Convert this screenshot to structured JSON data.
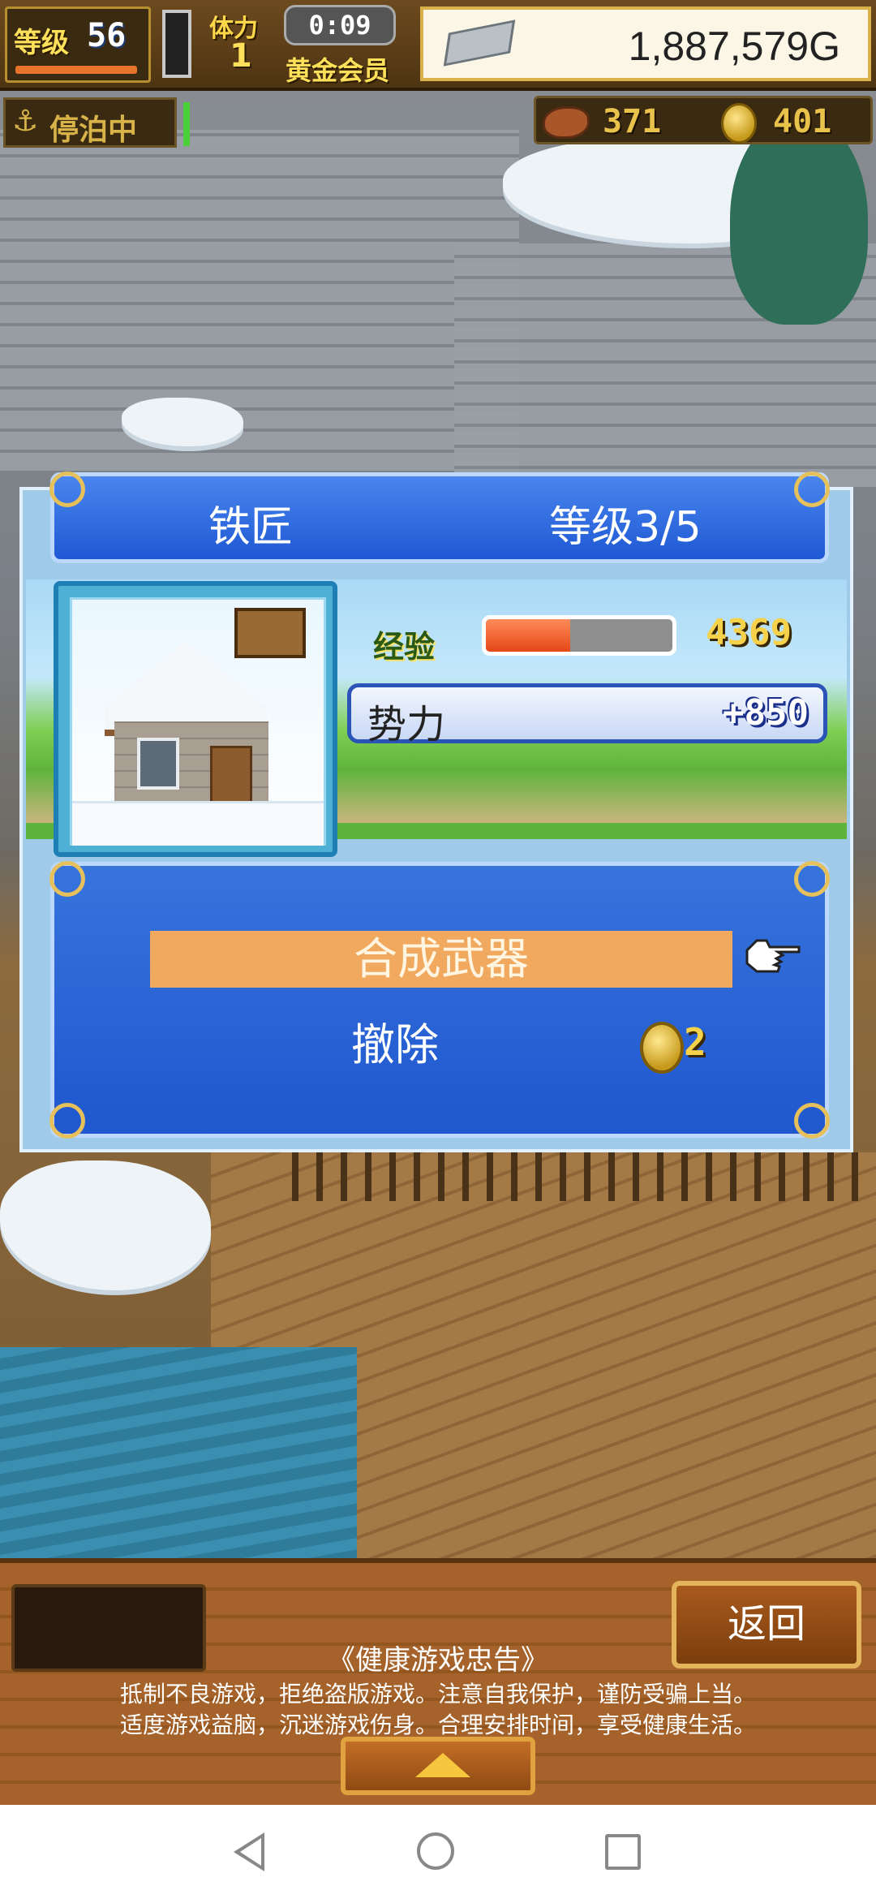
{
  "hud": {
    "level_label": "等级",
    "level_value": "56",
    "stamina_label": "体力",
    "stamina_value": "1",
    "timer": "0:09",
    "vip_label": "黄金会员",
    "gold": "1,887,579G",
    "status_label": "停泊中",
    "food": "371",
    "coins": "401"
  },
  "dialog": {
    "building_name": "铁匠",
    "level_text": "等级3/5",
    "exp_label": "经验",
    "exp_value": "4369",
    "exp_fill_fraction": 0.45,
    "power_label": "势力",
    "power_value": "+850",
    "actions": {
      "craft_label": "合成武器",
      "remove_label": "撤除",
      "remove_cost": "2"
    }
  },
  "bottom": {
    "back_label": "返回",
    "notice_title": "《健康游戏忠告》",
    "notice_line1": "抵制不良游戏，拒绝盗版游戏。注意自我保护，谨防受骗上当。",
    "notice_line2": "适度游戏益脑，沉迷游戏伤身。合理安排时间，享受健康生活。"
  },
  "colors": {
    "dialog_blue": "#1e58d4",
    "highlight_orange": "#f0a95e",
    "exp_red": "#e54716",
    "gold_text": "#f6d24b"
  }
}
